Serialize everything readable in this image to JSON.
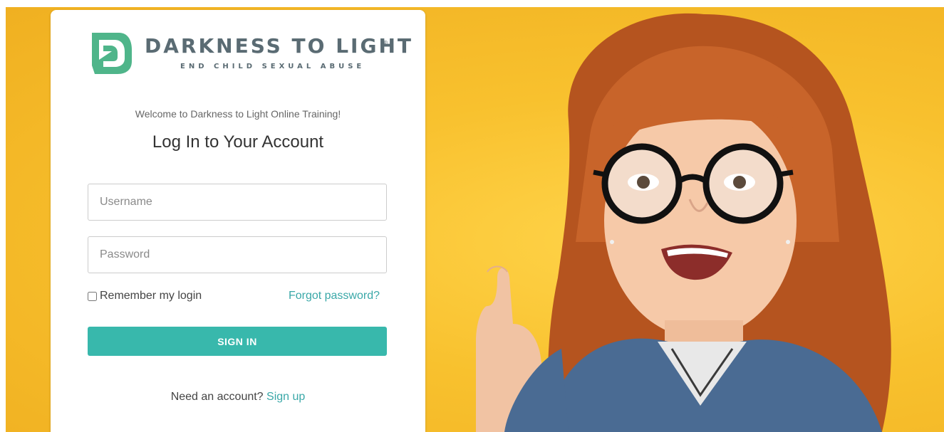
{
  "logo": {
    "name": "DARKNESS TO LIGHT",
    "registered": "®",
    "tagline": "END CHILD SEXUAL ABUSE",
    "mark_color": "#4fb58a",
    "text_color": "#5a6b73"
  },
  "login": {
    "welcome": "Welcome to Darkness to Light Online Training!",
    "heading": "Log In to Your Account",
    "username_placeholder": "Username",
    "password_placeholder": "Password",
    "remember_label": "Remember my login",
    "remember_checked": false,
    "forgot_label": "Forgot password?",
    "signin_label": "SIGN IN",
    "need_account": "Need an account?",
    "signup_label": "Sign up"
  },
  "colors": {
    "accent": "#38b8ac",
    "link": "#3aa8a8",
    "background": "#f8c12e"
  },
  "hero": {
    "icon": "child-with-glasses-photo"
  }
}
